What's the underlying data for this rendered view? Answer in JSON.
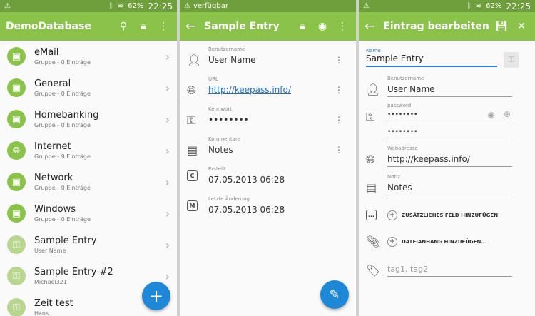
{
  "status_bar": {
    "time": "22:25",
    "battery": "62%",
    "mid_text": "verfügbar"
  },
  "list": {
    "title": "DemoDatabase",
    "items": [
      {
        "title": "eMail",
        "sub": "Gruppe - 0 Einträge",
        "icon": "group-icon"
      },
      {
        "title": "General",
        "sub": "Gruppe - 0 Einträge",
        "icon": "group-icon"
      },
      {
        "title": "Homebanking",
        "sub": "Gruppe - 0 Einträge",
        "icon": "group-icon"
      },
      {
        "title": "Internet",
        "sub": "Gruppe - 9 Einträge",
        "icon": "globe-icon"
      },
      {
        "title": "Network",
        "sub": "Gruppe - 0 Einträge",
        "icon": "group-icon"
      },
      {
        "title": "Windows",
        "sub": "Gruppe - 0 Einträge",
        "icon": "group-icon"
      },
      {
        "title": "Sample Entry",
        "sub": "User Name",
        "icon": "key-icon"
      },
      {
        "title": "Sample Entry #2",
        "sub": "Michael321",
        "icon": "key-icon"
      },
      {
        "title": "Zeit test",
        "sub": "Hans",
        "icon": "key-icon"
      }
    ],
    "fab": "+"
  },
  "detail": {
    "title": "Sample Entry",
    "fields": [
      {
        "label": "Benutzername",
        "value": "User Name"
      },
      {
        "label": "URL",
        "value": "http://keepass.info/"
      },
      {
        "label": "Kennwort",
        "value": "••••••••"
      },
      {
        "label": "Kommentare",
        "value": "Notes"
      },
      {
        "label": "Erstellt",
        "value": "07.05.2013 06:28",
        "badge": "C"
      },
      {
        "label": "Letzte Änderung",
        "value": "07.05.2013 06:28",
        "badge": "M"
      }
    ],
    "fab": "✎"
  },
  "edit": {
    "title": "Eintrag bearbeiten",
    "name_label": "Name",
    "name_value": "Sample Entry",
    "user_label": "Benutzername",
    "user_value": "User Name",
    "pw_label": "password",
    "pw_value": "••••••••",
    "pw_confirm": "••••••••",
    "web_label": "Webadresse",
    "web_value": "http://keepass.info/",
    "note_label": "Notiz",
    "note_value": "Notes",
    "add_field": "ZUSÄTZLICHES FELD HINZUFÜGEN",
    "add_attachment": "DATEIANHANG HINZUFÜGEN...",
    "tags_placeholder": "tag1, tag2"
  },
  "colors": {
    "appbar": "#8bc34a",
    "statusbar": "#6f9e3c",
    "fab": "#1f88d6",
    "link": "#1f6cbf"
  }
}
